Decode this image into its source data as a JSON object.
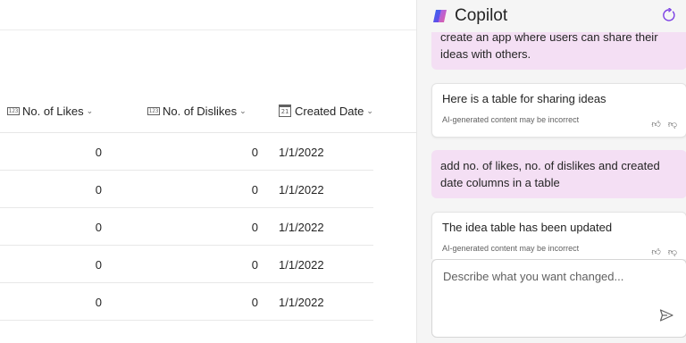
{
  "table": {
    "columns": [
      {
        "label": "No. of Likes",
        "type_badge": "123",
        "icon": "number-type-icon"
      },
      {
        "label": "No. of Dislikes",
        "type_badge": "123",
        "icon": "number-type-icon"
      },
      {
        "label": "Created Date",
        "type_badge": "21",
        "icon": "calendar-icon"
      }
    ],
    "rows": [
      {
        "likes": "0",
        "dislikes": "0",
        "created": "1/1/2022"
      },
      {
        "likes": "0",
        "dislikes": "0",
        "created": "1/1/2022"
      },
      {
        "likes": "0",
        "dislikes": "0",
        "created": "1/1/2022"
      },
      {
        "likes": "0",
        "dislikes": "0",
        "created": "1/1/2022"
      },
      {
        "likes": "0",
        "dislikes": "0",
        "created": "1/1/2022"
      }
    ]
  },
  "copilot": {
    "title": "Copilot",
    "messages": [
      {
        "role": "user",
        "text": "create an app where users can share their ideas with others."
      },
      {
        "role": "assistant",
        "text": "Here is a table for sharing ideas",
        "disclaimer": "AI-generated content may be incorrect"
      },
      {
        "role": "user",
        "text": "add no. of likes, no. of dislikes and created date columns in a table"
      },
      {
        "role": "assistant",
        "text": "The idea table has been updated",
        "disclaimer": "AI-generated content may be incorrect"
      }
    ],
    "input_placeholder": "Describe what you want changed...",
    "input_value": ""
  },
  "colors": {
    "user_bubble": "#f4dff4",
    "panel_bg": "#f5f5f5",
    "accent_copilot": "#7b3fe4"
  },
  "icons": [
    "number-type-icon",
    "calendar-icon",
    "chevron-down-icon",
    "copilot-logo-icon",
    "refresh-icon",
    "thumbs-up-icon",
    "thumbs-down-icon",
    "send-icon"
  ]
}
